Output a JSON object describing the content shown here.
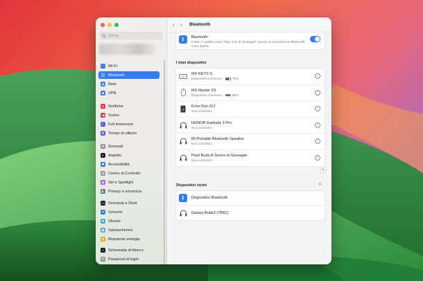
{
  "colors": {
    "accent": "#2f7cf6",
    "wallpaper_red": "#e5393a",
    "wallpaper_green": "#2e8a3e"
  },
  "window": {
    "title": "Bluetooth"
  },
  "sidebar": {
    "search_placeholder": "Cerca",
    "items": [
      {
        "label": "Wi-Fi",
        "icon": "wifi-icon",
        "color": "#2f7cf6"
      },
      {
        "label": "Bluetooth",
        "icon": "bluetooth-icon",
        "color": "#2f7cf6",
        "active": true
      },
      {
        "label": "Rete",
        "icon": "network-icon",
        "color": "#2f7cf6"
      },
      {
        "label": "VPN",
        "icon": "vpn-icon",
        "color": "#2f7cf6"
      },
      {
        "label": "Notifiche",
        "icon": "bell-icon",
        "color": "#e5393a"
      },
      {
        "label": "Suono",
        "icon": "speaker-icon",
        "color": "#e5393a"
      },
      {
        "label": "Full immersion",
        "icon": "moon-icon",
        "color": "#5e5ce6"
      },
      {
        "label": "Tempo di utilizzo",
        "icon": "hourglass-icon",
        "color": "#5e5ce6"
      },
      {
        "label": "Generali",
        "icon": "gear-icon",
        "color": "#8e8e93"
      },
      {
        "label": "Aspetto",
        "icon": "appearance-icon",
        "color": "#1d1d1f"
      },
      {
        "label": "Accessibilità",
        "icon": "accessibility-icon",
        "color": "#2f7cf6"
      },
      {
        "label": "Centro di Controllo",
        "icon": "control-center-icon",
        "color": "#8e8e93"
      },
      {
        "label": "Siri e Spotlight",
        "icon": "siri-icon",
        "color": "#b14fe0"
      },
      {
        "label": "Privacy e sicurezza",
        "icon": "hand-icon",
        "color": "#2f7cf6"
      },
      {
        "label": "Scrivania e Dock",
        "icon": "dock-icon",
        "color": "#1d1d1f"
      },
      {
        "label": "Schermi",
        "icon": "display-icon",
        "color": "#2f7cf6"
      },
      {
        "label": "Sfondo",
        "icon": "wallpaper-icon",
        "color": "#30b0c7"
      },
      {
        "label": "Salvaschermo",
        "icon": "screensaver-icon",
        "color": "#30b0c7"
      },
      {
        "label": "Risparmio energia",
        "icon": "battery-icon",
        "color": "#f0a020"
      },
      {
        "label": "Schermata di blocco",
        "icon": "lock-screen-icon",
        "color": "#1d1d1f"
      },
      {
        "label": "Password di login",
        "icon": "password-icon",
        "color": "#8e8e93"
      }
    ]
  },
  "bluetooth_card": {
    "title": "Bluetooth",
    "description": "Il Mac è visibile come \"Mac mini di Giuseppe\" mentre le impostazioni Bluetooth sono aperte.",
    "enabled": true
  },
  "my_devices": {
    "heading": "I miei dispositivi",
    "devices": [
      {
        "name": "MX KEYS S",
        "status": "Dispositivo connesso ·",
        "battery": "70%",
        "battery_level": 0.7,
        "icon": "keyboard-icon"
      },
      {
        "name": "MX Master 2S",
        "status": "Dispositivo connesso ·",
        "battery": "90%",
        "battery_level": 0.9,
        "icon": "mouse-icon"
      },
      {
        "name": "Echo Dot-JVJ",
        "status": "Non connesso",
        "icon": "speaker-device-icon"
      },
      {
        "name": "HONOR Earbuds 3 Pro",
        "status": "Non connesso",
        "icon": "headphones-icon"
      },
      {
        "name": "Mi Portable Bluetooth Speaker",
        "status": "Non connesso",
        "icon": "headphones-icon"
      },
      {
        "name": "Pixel Buds A-Series di Giuseppe",
        "status": "Non connesso",
        "icon": "headphones-icon"
      }
    ]
  },
  "help_label": "?",
  "nearby": {
    "heading": "Dispositivi vicini",
    "devices": [
      {
        "name": "Dispositivo Bluetooth",
        "icon": "bluetooth-icon"
      },
      {
        "name": "Galaxy Buds2 (785C)",
        "icon": "headphones-icon"
      }
    ]
  }
}
